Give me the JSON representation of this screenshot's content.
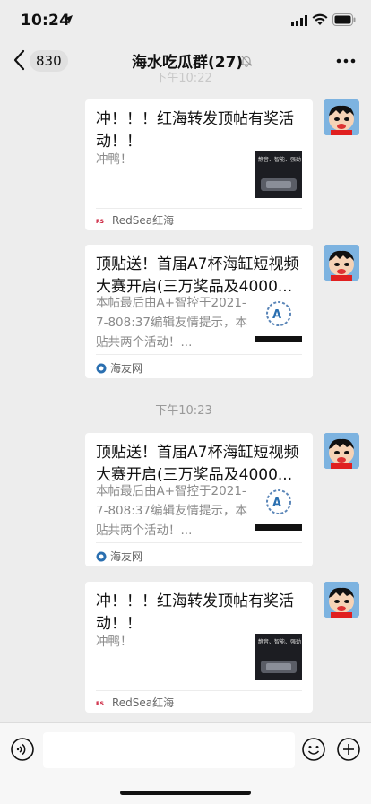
{
  "status_bar": {
    "time": "10:24"
  },
  "nav": {
    "back_count": "830",
    "title": "海水吃瓜群(27)"
  },
  "faded_time": "下午10:22",
  "messages": [
    {
      "title": "冲！！！红海转发顶帖有奖活动！！",
      "desc": "冲鸭！",
      "thumb_text": "静音、智能、强劲",
      "source": "RedSea红海",
      "source_icon": "redsea-logo-icon"
    },
    {
      "title": "顶贴送！首届A7杯海缸短视频大赛开启(三万奖品及4000...",
      "desc": "本帖最后由A+智控于2021-7-808:37编辑友情提示，本贴共两个活动！...",
      "source": "海友网",
      "source_icon": "haiyou-logo-icon"
    },
    {
      "title": "顶贴送！首届A7杯海缸短视频大赛开启(三万奖品及4000...",
      "desc": "本帖最后由A+智控于2021-7-808:37编辑友情提示，本贴共两个活动！...",
      "source": "海友网",
      "source_icon": "haiyou-logo-icon"
    },
    {
      "title": "冲！！！红海转发顶帖有奖活动！！",
      "desc": "冲鸭！",
      "thumb_text": "静音、智能、强劲",
      "source": "RedSea红海",
      "source_icon": "redsea-logo-icon"
    }
  ],
  "time_label": "下午10:23",
  "colors": {
    "background": "#ededed",
    "card": "#ffffff",
    "accent_blue": "#2a6fb0"
  }
}
